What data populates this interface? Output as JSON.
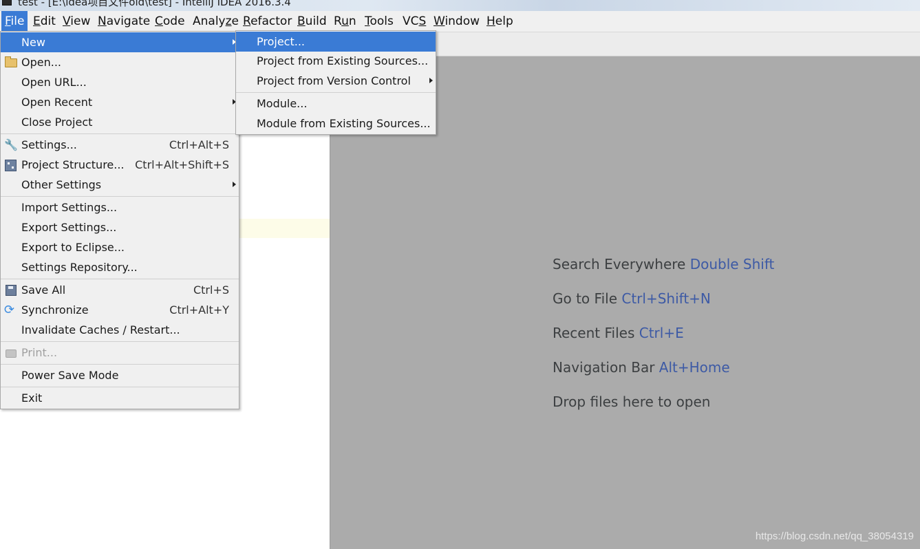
{
  "window": {
    "title": "test - [E:\\idea项目文件old\\test] - IntelliJ IDEA 2016.3.4"
  },
  "menubar": {
    "items": [
      {
        "label": "File"
      },
      {
        "label": "Edit"
      },
      {
        "label": "View"
      },
      {
        "label": "Navigate"
      },
      {
        "label": "Code"
      },
      {
        "label": "Analyze"
      },
      {
        "label": "Refactor"
      },
      {
        "label": "Build"
      },
      {
        "label": "Run"
      },
      {
        "label": "Tools"
      },
      {
        "label": "VCS"
      },
      {
        "label": "Window"
      },
      {
        "label": "Help"
      }
    ]
  },
  "file_menu": {
    "new": "New",
    "open": "Open...",
    "open_url": "Open URL...",
    "open_recent": "Open Recent",
    "close_project": "Close Project",
    "settings": "Settings...",
    "settings_sc": "Ctrl+Alt+S",
    "project_structure": "Project Structure...",
    "project_structure_sc": "Ctrl+Alt+Shift+S",
    "other_settings": "Other Settings",
    "import_settings": "Import Settings...",
    "export_settings": "Export Settings...",
    "export_eclipse": "Export to Eclipse...",
    "settings_repo": "Settings Repository...",
    "save_all": "Save All",
    "save_all_sc": "Ctrl+S",
    "synchronize": "Synchronize",
    "synchronize_sc": "Ctrl+Alt+Y",
    "invalidate": "Invalidate Caches / Restart...",
    "print": "Print...",
    "power_save": "Power Save Mode",
    "exit": "Exit"
  },
  "new_submenu": {
    "project": "Project...",
    "project_existing": "Project from Existing Sources...",
    "project_vcs": "Project from Version Control",
    "module": "Module...",
    "module_existing": "Module from Existing Sources..."
  },
  "editor_hints": [
    {
      "text": "Search Everywhere",
      "key": "Double Shift"
    },
    {
      "text": "Go to File",
      "key": "Ctrl+Shift+N"
    },
    {
      "text": "Recent Files",
      "key": "Ctrl+E"
    },
    {
      "text": "Navigation Bar",
      "key": "Alt+Home"
    },
    {
      "text": "Drop files here to open",
      "key": ""
    }
  ],
  "watermark": "https://blog.csdn.net/qq_38054319",
  "colors": {
    "selection": "#3a7bd5",
    "shortcut_hint": "#3d5aa5",
    "editor_bg": "#ababab"
  }
}
